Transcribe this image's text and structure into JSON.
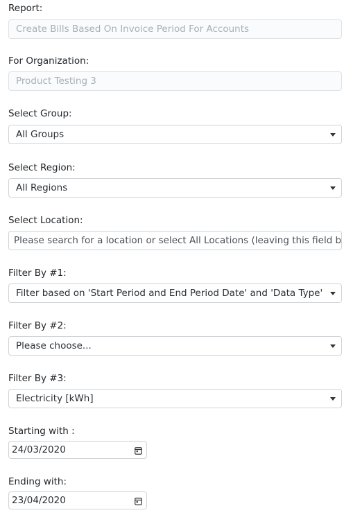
{
  "report": {
    "label": "Report:",
    "value": "Create Bills Based On Invoice Period For Accounts"
  },
  "organization": {
    "label": "For Organization:",
    "value": "Product Testing 3"
  },
  "group": {
    "label": "Select Group:",
    "selected": "All Groups"
  },
  "region": {
    "label": "Select Region:",
    "selected": "All Regions"
  },
  "location": {
    "label": "Select Location:",
    "placeholder": "Please search for a location or select All Locations (leaving this field blank = all locations)",
    "value": ""
  },
  "filter1": {
    "label": "Filter By #1:",
    "selected": "Filter based on 'Start Period and End Period Date' and 'Data Type'"
  },
  "filter2": {
    "label": "Filter By #2:",
    "selected": "Please choose..."
  },
  "filter3": {
    "label": "Filter By #3:",
    "selected": "Electricity [kWh]"
  },
  "starting": {
    "label": "Starting with :",
    "value": "24/03/2020",
    "icon": "calendar-icon"
  },
  "ending": {
    "label": "Ending with:",
    "value": "23/04/2020",
    "icon": "calendar-icon"
  }
}
